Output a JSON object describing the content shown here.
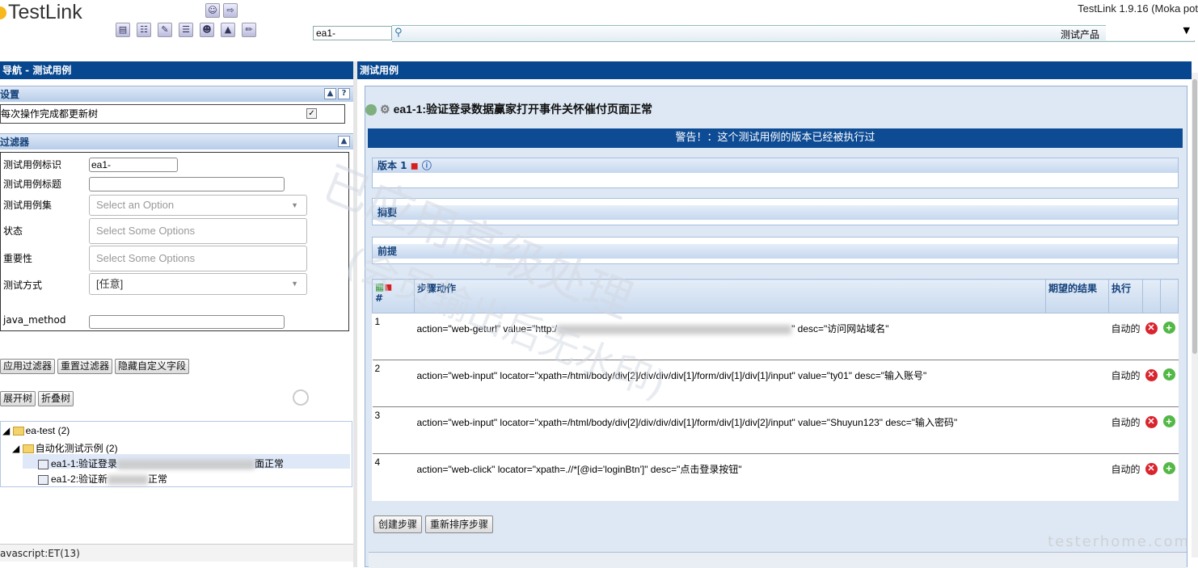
{
  "app": {
    "logo_text": "TestLink",
    "version": "TestLink 1.9.16 (Moka pot",
    "search_value": "ea1-",
    "product_label": "测试产品",
    "status_text": "avascript:ET(13)"
  },
  "left": {
    "header": "导航 - 测试用例",
    "settings": {
      "title": "设置",
      "update_tree_label": "每次操作完成都更新树",
      "update_tree_checked": true
    },
    "filters": {
      "title": "过滤器",
      "tc_id_label": "测试用例标识",
      "tc_id_value": "ea1-",
      "tc_title_label": "测试用例标题",
      "testsuite_label": "测试用例集",
      "testsuite_placeholder": "Select an Option",
      "status_label": "状态",
      "status_placeholder": "Select Some Options",
      "importance_label": "重要性",
      "importance_placeholder": "Select Some Options",
      "exec_type_label": "测试方式",
      "exec_type_value": "[任意]",
      "java_method_label": "java_method"
    },
    "buttons": {
      "apply": "应用过滤器",
      "reset": "重置过滤器",
      "hide_custom": "隐藏自定义字段",
      "expand": "展开树",
      "collapse": "折叠树"
    },
    "tree": {
      "root": "ea-test (2)",
      "suite": "自动化测试示例 (2)",
      "case1_prefix": "ea1-1:验证登录",
      "case1_suffix": "面正常",
      "case2_prefix": "ea1-2:验证新",
      "case2_suffix": "正常"
    }
  },
  "right": {
    "header": "测试用例",
    "tc_title": "ea1-1:验证登录数据赢家打开事件关怀催付页面正常",
    "warning": "警告！：这个测试用例的版本已经被执行过",
    "version_label": "版本 1",
    "summary_label": "摘要",
    "preconditions_label": "前提",
    "columns": {
      "num": "#",
      "actions": "步骤动作",
      "expected": "期望的结果",
      "exec": "执行"
    },
    "steps": [
      {
        "num": "1",
        "action": "action=\"web-geturl\" value=\"http:/",
        "action_tail": "\" desc=\"访问网站域名\"",
        "exec": "自动的"
      },
      {
        "num": "2",
        "action": "action=\"web-input\" locator=\"xpath=/html/body/div[2]/div/div/div[1]/form/div[1]/div[1]/input\" value=\"ty01\" desc=\"输入账号\"",
        "action_tail": "",
        "exec": "自动的"
      },
      {
        "num": "3",
        "action": "action=\"web-input\" locator=\"xpath=/html/body/div[2]/div/div/div[1]/form/div[1]/div[2]/input\" value=\"Shuyun123\" desc=\"输入密码\"",
        "action_tail": "",
        "exec": "自动的"
      },
      {
        "num": "4",
        "action": "action=\"web-click\" locator=\"xpath=.//*[@id='loginBtn']\" desc=\"点击登录按钮\"",
        "action_tail": "",
        "exec": "自动的"
      }
    ],
    "buttons": {
      "create_step": "创建步骤",
      "reorder_steps": "重新排序步骤"
    }
  },
  "watermark": {
    "line1": "已应用高级处理",
    "line2": "(会员输出后无水印)",
    "site": "testerhome.com"
  },
  "colors": {
    "header_bg": "#06478f",
    "warning_bg": "#0d4b94",
    "delete_icon": "#d9242e",
    "add_icon": "#54b847"
  }
}
